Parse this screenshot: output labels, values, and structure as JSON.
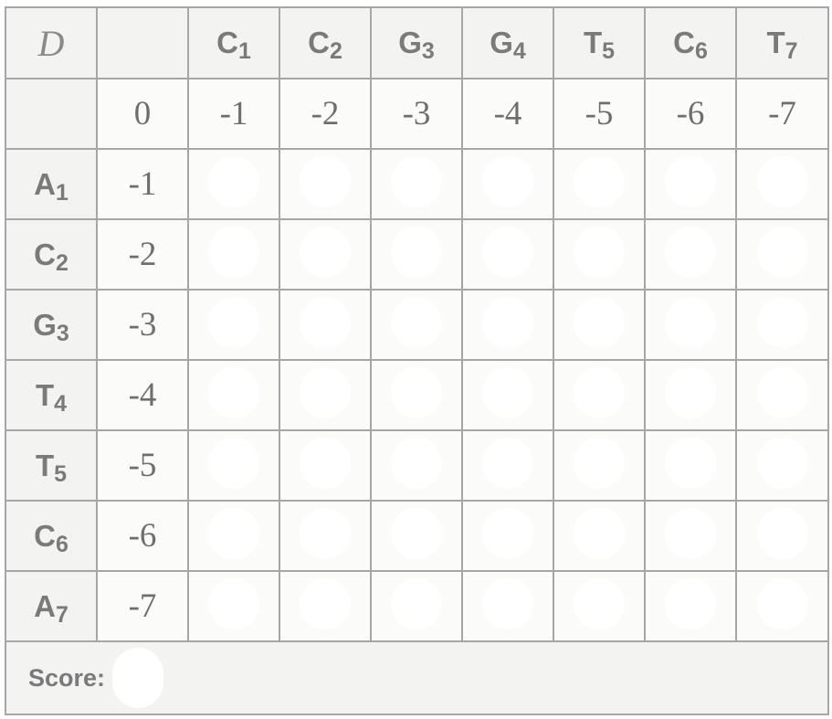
{
  "corner_symbol": "D",
  "column_headers": [
    {
      "base": "C",
      "index": "1"
    },
    {
      "base": "C",
      "index": "2"
    },
    {
      "base": "G",
      "index": "3"
    },
    {
      "base": "G",
      "index": "4"
    },
    {
      "base": "T",
      "index": "5"
    },
    {
      "base": "C",
      "index": "6"
    },
    {
      "base": "T",
      "index": "7"
    }
  ],
  "first_row_values": [
    "0",
    "-1",
    "-2",
    "-3",
    "-4",
    "-5",
    "-6",
    "-7"
  ],
  "rows": [
    {
      "base": "A",
      "index": "1",
      "value": "-1"
    },
    {
      "base": "C",
      "index": "2",
      "value": "-2"
    },
    {
      "base": "G",
      "index": "3",
      "value": "-3"
    },
    {
      "base": "T",
      "index": "4",
      "value": "-4"
    },
    {
      "base": "T",
      "index": "5",
      "value": "-5"
    },
    {
      "base": "C",
      "index": "6",
      "value": "-6"
    },
    {
      "base": "A",
      "index": "7",
      "value": "-7"
    }
  ],
  "score_label": "Score:",
  "colors": {
    "header_background": "#f3f3f2",
    "cell_background": "#fbfbf9",
    "grid_line": "#a6a6a6",
    "input_slot": "#ffffff",
    "header_text": "#7a7a7a"
  }
}
